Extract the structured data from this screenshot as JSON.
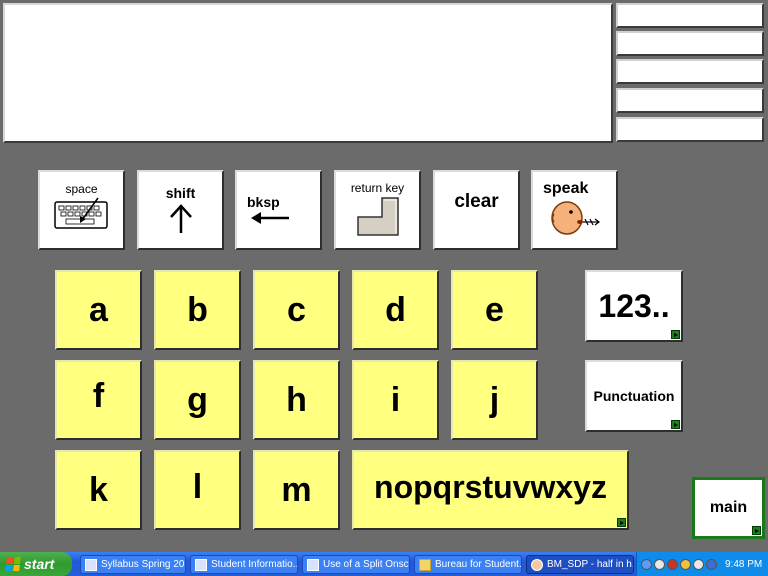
{
  "display": {
    "message": ""
  },
  "function_keys": {
    "space": "space",
    "shift": "shift",
    "backspace": "bksp",
    "return": "return key",
    "clear": "clear",
    "speak": "speak"
  },
  "letters": {
    "row1": [
      "a",
      "b",
      "c",
      "d",
      "e"
    ],
    "row2": [
      "f",
      "g",
      "h",
      "i",
      "j"
    ],
    "row3": [
      "k",
      "l",
      "m"
    ],
    "rest": "nopqrstuvwxyz"
  },
  "side_keys": {
    "numbers": "123..",
    "punctuation": "Punctuation",
    "main": "main"
  },
  "taskbar": {
    "start": "start",
    "tasks": [
      "Syllabus Spring 20...",
      "Student Informatio...",
      "Use of a Split Onsc...",
      "Bureau for Student...",
      "BM_SDP - half in h..."
    ],
    "clock": "9:48 PM"
  },
  "colors": {
    "key_yellow": "#ffff80",
    "background": "#6b6b6b",
    "key_white": "#ffffff"
  }
}
